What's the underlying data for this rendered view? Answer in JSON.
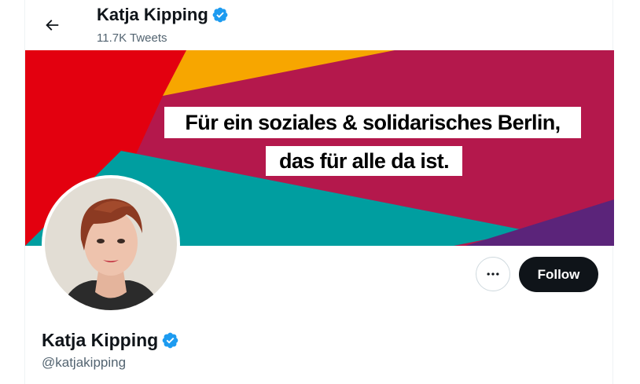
{
  "header": {
    "name": "Katja Kipping",
    "tweet_count": "11.7K Tweets"
  },
  "banner": {
    "line1": "Für ein soziales & solidarisches Berlin,",
    "line2": "das für alle da ist.",
    "colors": [
      "#e3000f",
      "#f7a600",
      "#b4184c",
      "#009ea0",
      "#5b247a"
    ]
  },
  "profile": {
    "name": "Katja Kipping",
    "handle": "@katjakipping",
    "verified": true
  },
  "actions": {
    "follow_label": "Follow"
  },
  "icons": {
    "back": "arrow-left-icon",
    "verified": "verified-badge-icon",
    "more": "more-dots-icon"
  },
  "accent_color": "#1d9bf0"
}
